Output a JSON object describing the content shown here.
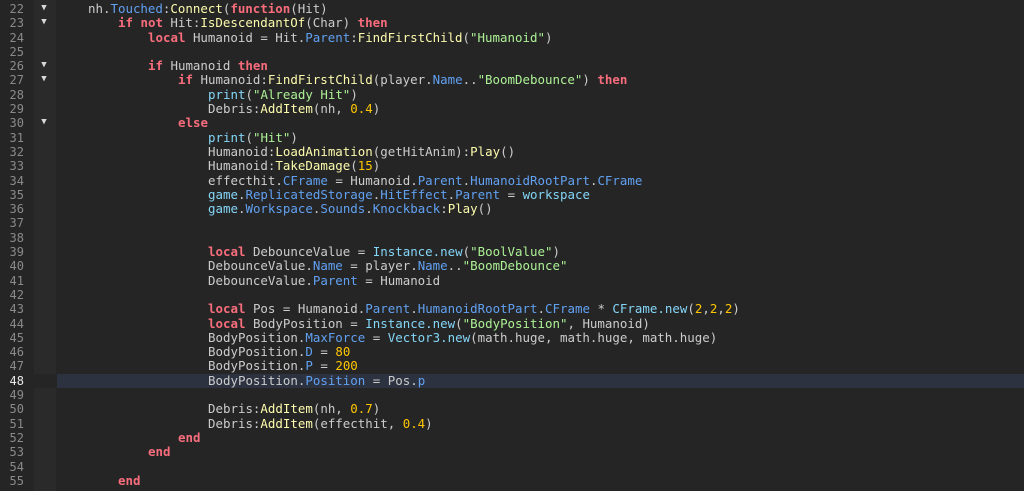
{
  "editor": {
    "current_line": 48,
    "colors": {
      "background": "#252526",
      "keyword": "#f86d7c",
      "property": "#61a1f1",
      "method": "#fdfbac",
      "builtin": "#84d6f7",
      "string": "#adf195",
      "number": "#ffc600",
      "text": "#cccccc",
      "current_line": "#2d3241"
    },
    "lines": [
      {
        "n": "22",
        "fold": true,
        "indent": 1,
        "tokens": [
          [
            "i",
            "nh"
          ],
          [
            "o",
            "."
          ],
          [
            "p",
            "Touched"
          ],
          [
            "o",
            ":"
          ],
          [
            "f",
            "Connect"
          ],
          [
            "o",
            "("
          ],
          [
            "k",
            "function"
          ],
          [
            "i",
            "(Hit)"
          ]
        ]
      },
      {
        "n": "23",
        "fold": true,
        "indent": 2,
        "tokens": [
          [
            "k",
            "if not"
          ],
          [
            "i",
            " Hit:"
          ],
          [
            "f",
            "IsDescendantOf"
          ],
          [
            "i",
            "(Char) "
          ],
          [
            "k",
            "then"
          ]
        ]
      },
      {
        "n": "24",
        "indent": 3,
        "tokens": [
          [
            "k",
            "local"
          ],
          [
            "i",
            " Humanoid = Hit."
          ],
          [
            "p",
            "Parent"
          ],
          [
            "o",
            ":"
          ],
          [
            "f",
            "FindFirstChild"
          ],
          [
            "o",
            "("
          ],
          [
            "s",
            "\"Humanoid\""
          ],
          [
            "o",
            ")"
          ]
        ]
      },
      {
        "n": "25",
        "indent": 0,
        "tokens": []
      },
      {
        "n": "26",
        "fold": true,
        "indent": 3,
        "tokens": [
          [
            "k",
            "if"
          ],
          [
            "i",
            " Humanoid "
          ],
          [
            "k",
            "then"
          ]
        ]
      },
      {
        "n": "27",
        "fold": true,
        "indent": 4,
        "tokens": [
          [
            "k",
            "if"
          ],
          [
            "i",
            " Humanoid:"
          ],
          [
            "f",
            "FindFirstChild"
          ],
          [
            "i",
            "(player."
          ],
          [
            "p",
            "Name"
          ],
          [
            "o",
            ".."
          ],
          [
            "s",
            "\"BoomDebounce\""
          ],
          [
            "o",
            ") "
          ],
          [
            "k",
            "then"
          ]
        ]
      },
      {
        "n": "28",
        "indent": 5,
        "tokens": [
          [
            "b",
            "print"
          ],
          [
            "o",
            "("
          ],
          [
            "s",
            "\"Already Hit\""
          ],
          [
            "o",
            ")"
          ]
        ]
      },
      {
        "n": "29",
        "indent": 5,
        "tokens": [
          [
            "i",
            "Debris:"
          ],
          [
            "f",
            "AddItem"
          ],
          [
            "i",
            "(nh, "
          ],
          [
            "n",
            "0.4"
          ],
          [
            "o",
            ")"
          ]
        ]
      },
      {
        "n": "30",
        "fold": true,
        "indent": 4,
        "tokens": [
          [
            "k",
            "else"
          ]
        ]
      },
      {
        "n": "31",
        "indent": 5,
        "tokens": [
          [
            "b",
            "print"
          ],
          [
            "o",
            "("
          ],
          [
            "s",
            "\"Hit\""
          ],
          [
            "o",
            ")"
          ]
        ]
      },
      {
        "n": "32",
        "indent": 5,
        "tokens": [
          [
            "i",
            "Humanoid:"
          ],
          [
            "f",
            "LoadAnimation"
          ],
          [
            "i",
            "(getHitAnim):"
          ],
          [
            "f",
            "Play"
          ],
          [
            "o",
            "()"
          ]
        ]
      },
      {
        "n": "33",
        "indent": 5,
        "tokens": [
          [
            "i",
            "Humanoid:"
          ],
          [
            "f",
            "TakeDamage"
          ],
          [
            "o",
            "("
          ],
          [
            "n",
            "15"
          ],
          [
            "o",
            ")"
          ]
        ]
      },
      {
        "n": "34",
        "indent": 5,
        "tokens": [
          [
            "i",
            "effecthit."
          ],
          [
            "p",
            "CFrame"
          ],
          [
            "i",
            " = Humanoid."
          ],
          [
            "p",
            "Parent"
          ],
          [
            "o",
            "."
          ],
          [
            "p",
            "HumanoidRootPart"
          ],
          [
            "o",
            "."
          ],
          [
            "p",
            "CFrame"
          ]
        ]
      },
      {
        "n": "35",
        "indent": 5,
        "tokens": [
          [
            "b",
            "game"
          ],
          [
            "o",
            "."
          ],
          [
            "p",
            "ReplicatedStorage"
          ],
          [
            "o",
            "."
          ],
          [
            "p",
            "HitEffect"
          ],
          [
            "o",
            "."
          ],
          [
            "p",
            "Parent"
          ],
          [
            "o",
            " = "
          ],
          [
            "b",
            "workspace"
          ]
        ]
      },
      {
        "n": "36",
        "indent": 5,
        "tokens": [
          [
            "b",
            "game"
          ],
          [
            "o",
            "."
          ],
          [
            "p",
            "Workspace"
          ],
          [
            "o",
            "."
          ],
          [
            "p",
            "Sounds"
          ],
          [
            "o",
            "."
          ],
          [
            "p",
            "Knockback"
          ],
          [
            "o",
            ":"
          ],
          [
            "f",
            "Play"
          ],
          [
            "o",
            "()"
          ]
        ]
      },
      {
        "n": "37",
        "indent": 0,
        "tokens": []
      },
      {
        "n": "38",
        "indent": 0,
        "tokens": []
      },
      {
        "n": "39",
        "indent": 5,
        "tokens": [
          [
            "k",
            "local"
          ],
          [
            "i",
            " DebounceValue = "
          ],
          [
            "b",
            "Instance.new"
          ],
          [
            "o",
            "("
          ],
          [
            "s",
            "\"BoolValue\""
          ],
          [
            "o",
            ")"
          ]
        ]
      },
      {
        "n": "40",
        "indent": 5,
        "tokens": [
          [
            "i",
            "DebounceValue."
          ],
          [
            "p",
            "Name"
          ],
          [
            "i",
            " = player."
          ],
          [
            "p",
            "Name"
          ],
          [
            "o",
            ".."
          ],
          [
            "s",
            "\"BoomDebounce\""
          ]
        ]
      },
      {
        "n": "41",
        "indent": 5,
        "tokens": [
          [
            "i",
            "DebounceValue."
          ],
          [
            "p",
            "Parent"
          ],
          [
            "i",
            " = Humanoid"
          ]
        ]
      },
      {
        "n": "42",
        "indent": 0,
        "tokens": []
      },
      {
        "n": "43",
        "indent": 5,
        "tokens": [
          [
            "k",
            "local"
          ],
          [
            "i",
            " Pos = Humanoid."
          ],
          [
            "p",
            "Parent"
          ],
          [
            "o",
            "."
          ],
          [
            "p",
            "HumanoidRootPart"
          ],
          [
            "o",
            "."
          ],
          [
            "p",
            "CFrame"
          ],
          [
            "o",
            " * "
          ],
          [
            "b",
            "CFrame.new"
          ],
          [
            "o",
            "("
          ],
          [
            "n",
            "2"
          ],
          [
            "o",
            ","
          ],
          [
            "n",
            "2"
          ],
          [
            "o",
            ","
          ],
          [
            "n",
            "2"
          ],
          [
            "o",
            ")"
          ]
        ]
      },
      {
        "n": "44",
        "indent": 5,
        "tokens": [
          [
            "k",
            "local"
          ],
          [
            "i",
            " BodyPosition = "
          ],
          [
            "b",
            "Instance.new"
          ],
          [
            "o",
            "("
          ],
          [
            "s",
            "\"BodyPosition\""
          ],
          [
            "i",
            ", Humanoid)"
          ]
        ]
      },
      {
        "n": "45",
        "indent": 5,
        "tokens": [
          [
            "i",
            "BodyPosition."
          ],
          [
            "p",
            "MaxForce"
          ],
          [
            "o",
            " = "
          ],
          [
            "b",
            "Vector3.new"
          ],
          [
            "i",
            "(math.huge, math.huge, math.huge)"
          ]
        ]
      },
      {
        "n": "46",
        "indent": 5,
        "tokens": [
          [
            "i",
            "BodyPosition."
          ],
          [
            "p",
            "D"
          ],
          [
            "o",
            " = "
          ],
          [
            "n",
            "80"
          ]
        ]
      },
      {
        "n": "47",
        "indent": 5,
        "tokens": [
          [
            "i",
            "BodyPosition."
          ],
          [
            "p",
            "P"
          ],
          [
            "o",
            " = "
          ],
          [
            "n",
            "200"
          ]
        ]
      },
      {
        "n": "48",
        "indent": 5,
        "tokens": [
          [
            "i",
            "BodyPosition."
          ],
          [
            "p",
            "Position"
          ],
          [
            "i",
            " = Pos."
          ],
          [
            "p",
            "p"
          ]
        ]
      },
      {
        "n": "49",
        "indent": 0,
        "tokens": []
      },
      {
        "n": "50",
        "indent": 5,
        "tokens": [
          [
            "i",
            "Debris:"
          ],
          [
            "f",
            "AddItem"
          ],
          [
            "i",
            "(nh, "
          ],
          [
            "n",
            "0.7"
          ],
          [
            "o",
            ")"
          ]
        ]
      },
      {
        "n": "51",
        "indent": 5,
        "tokens": [
          [
            "i",
            "Debris:"
          ],
          [
            "f",
            "AddItem"
          ],
          [
            "i",
            "(effecthit, "
          ],
          [
            "n",
            "0.4"
          ],
          [
            "o",
            ")"
          ]
        ]
      },
      {
        "n": "52",
        "indent": 4,
        "tokens": [
          [
            "k",
            "end"
          ]
        ]
      },
      {
        "n": "53",
        "indent": 3,
        "tokens": [
          [
            "k",
            "end"
          ]
        ]
      },
      {
        "n": "54",
        "indent": 0,
        "tokens": []
      },
      {
        "n": "55",
        "indent": 2,
        "tokens": [
          [
            "k",
            "end"
          ]
        ]
      }
    ]
  }
}
